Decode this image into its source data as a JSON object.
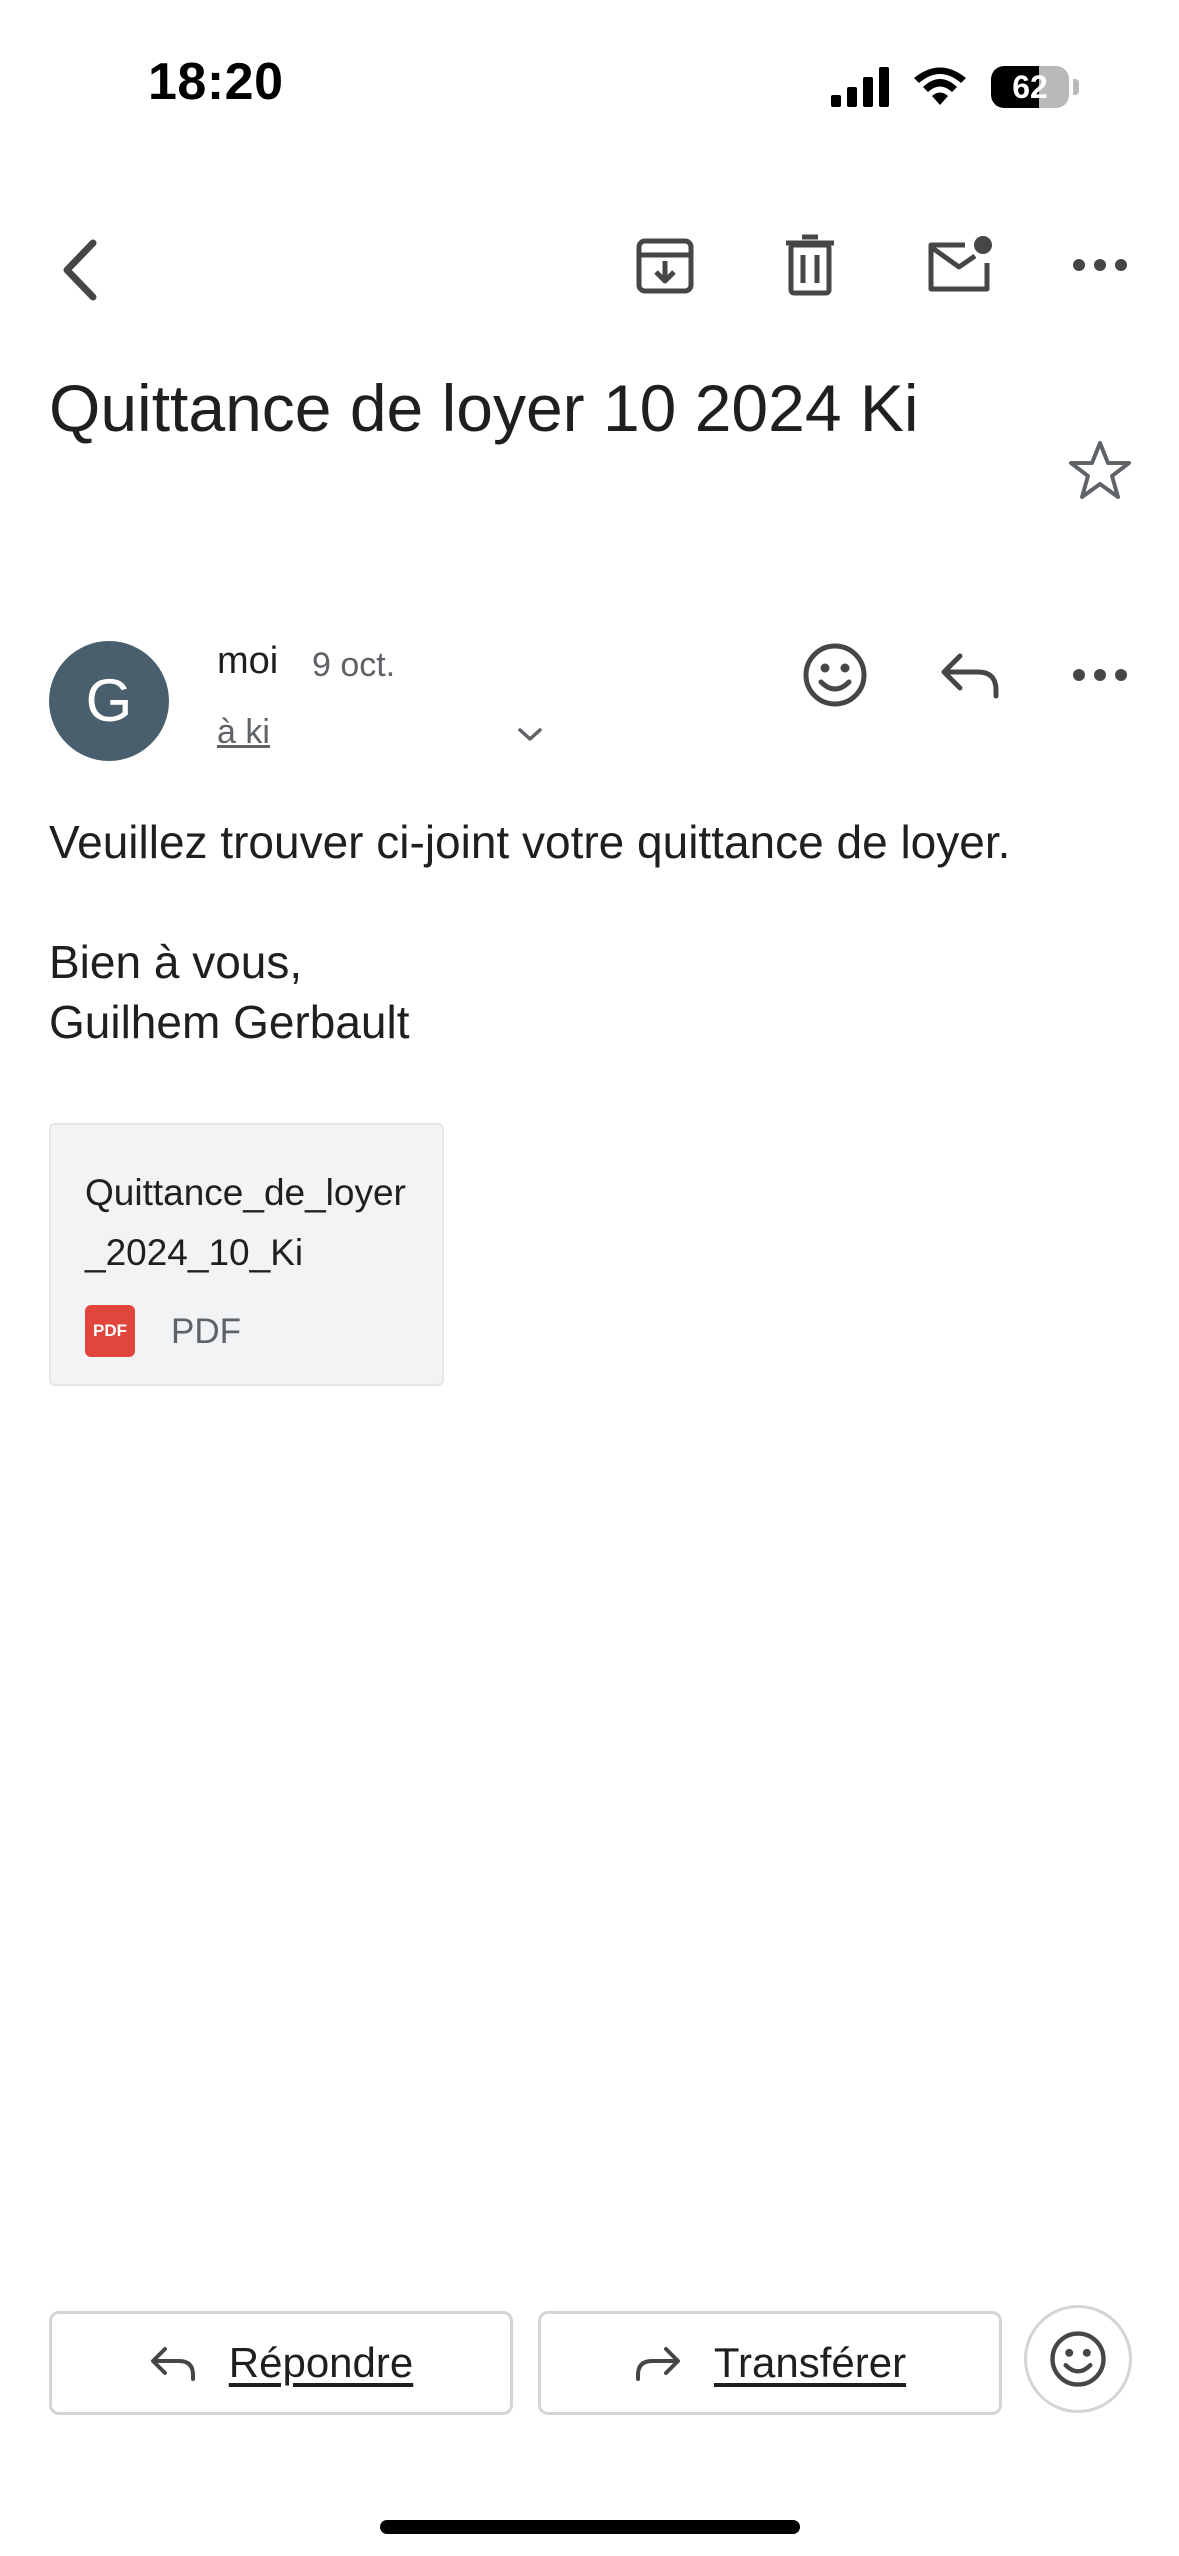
{
  "status_bar": {
    "time": "18:20",
    "battery_percent": "62",
    "battery_level": 0.62
  },
  "toolbar": {
    "icons": [
      "back-arrow-icon",
      "archive-icon",
      "trash-icon",
      "mark-unread-icon",
      "more-icon"
    ]
  },
  "email": {
    "subject": "Quittance de loyer 10 2024 Ki",
    "starred": false,
    "sender": {
      "avatar_letter": "G",
      "avatar_color": "#4a5f6d",
      "name": "moi",
      "date": "9 oct.",
      "recipient": "à ki"
    },
    "body": {
      "line1": "Veuillez trouver ci-joint votre quittance de loyer.",
      "line2": "Bien à vous,",
      "line3": "Guilhem Gerbault"
    },
    "attachment": {
      "name": "Quittance_de_loyer_2024_10_Ki",
      "badge": "PDF",
      "type": "PDF"
    }
  },
  "actions": {
    "reply_label": "Répondre",
    "forward_label": "Transférer"
  },
  "colors": {
    "pdf_red": "#e0463b",
    "icon_gray": "#5f6368",
    "border": "#d2d4d6"
  }
}
